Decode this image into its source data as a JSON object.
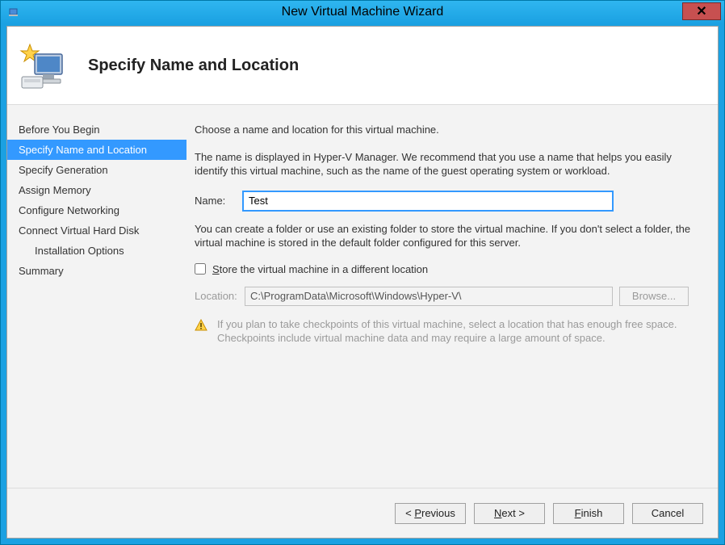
{
  "window": {
    "title": "New Virtual Machine Wizard",
    "close_tooltip": "Close"
  },
  "header": {
    "title": "Specify Name and Location"
  },
  "sidebar": {
    "items": [
      {
        "label": "Before You Begin",
        "selected": false,
        "indent": false
      },
      {
        "label": "Specify Name and Location",
        "selected": true,
        "indent": false
      },
      {
        "label": "Specify Generation",
        "selected": false,
        "indent": false
      },
      {
        "label": "Assign Memory",
        "selected": false,
        "indent": false
      },
      {
        "label": "Configure Networking",
        "selected": false,
        "indent": false
      },
      {
        "label": "Connect Virtual Hard Disk",
        "selected": false,
        "indent": false
      },
      {
        "label": "Installation Options",
        "selected": false,
        "indent": true
      },
      {
        "label": "Summary",
        "selected": false,
        "indent": false
      }
    ]
  },
  "main": {
    "intro": "Choose a name and location for this virtual machine.",
    "desc": "The name is displayed in Hyper-V Manager. We recommend that you use a name that helps you easily identify this virtual machine, such as the name of the guest operating system or workload.",
    "name_label": "Name:",
    "name_value": "Test",
    "folder_desc": "You can create a folder or use an existing folder to store the virtual machine. If you don't select a folder, the virtual machine is stored in the default folder configured for this server.",
    "store_checkbox_label": "Store the virtual machine in a different location",
    "store_checked": false,
    "location_label": "Location:",
    "location_value": "C:\\ProgramData\\Microsoft\\Windows\\Hyper-V\\",
    "browse_label": "Browse...",
    "warning": "If you plan to take checkpoints of this virtual machine, select a location that has enough free space. Checkpoints include virtual machine data and may require a large amount of space."
  },
  "buttons": {
    "previous": "< Previous",
    "next": "Next >",
    "finish": "Finish",
    "cancel": "Cancel"
  }
}
